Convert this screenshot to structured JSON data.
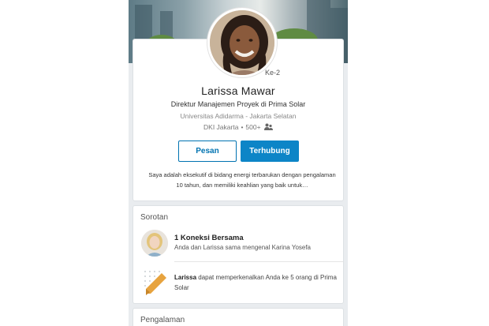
{
  "profile": {
    "degree": "Ke-2",
    "name": "Larissa Mawar",
    "headline": "Direktur Manajemen Proyek di Prima Solar",
    "school": "Universitas Adidarma - Jakarta Selatan",
    "location": "DKI Jakarta",
    "connections": "500+",
    "summary": "Saya adalah eksekutif di bidang energi terbarukan dengan pengalaman 10 tahun, dan memiliki keahlian yang baik untuk…"
  },
  "actions": {
    "message_label": "Pesan",
    "connect_label": "Terhubung"
  },
  "highlights": {
    "title": "Sorotan",
    "mutual_title": "1 Koneksi Bersama",
    "mutual_sub": "Anda dan Larissa sama mengenal Karina Yosefa",
    "intro_name": "Larissa",
    "intro_text": " dapat memperkenalkan Anda ke 5 orang di Prima Solar"
  },
  "experience": {
    "title": "Pengalaman"
  },
  "icons": {
    "connections": "people-icon",
    "intro": "ribbon-icon"
  },
  "colors": {
    "accent": "#0073b1",
    "accent_fill": "#0d85c7",
    "ribbon": "#e7a33e",
    "background": "#e9ecef"
  }
}
